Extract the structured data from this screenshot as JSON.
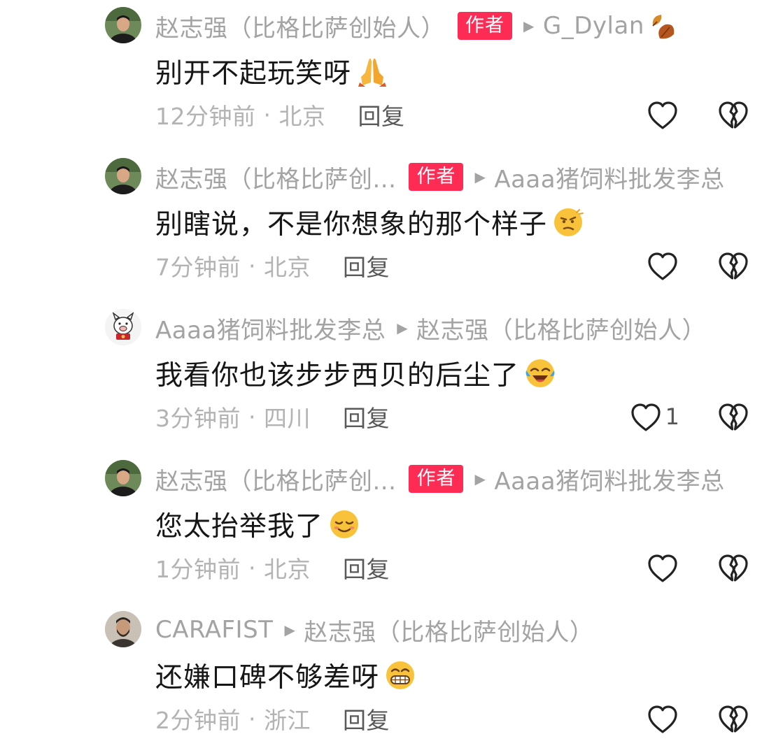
{
  "comments": [
    {
      "author": "赵志强（比格比萨创始人）",
      "author_badge": "作者",
      "reply_to": "G_Dylan",
      "reply_to_emoji": "maple-leaf-icon",
      "text": "别开不起玩笑呀",
      "emoji": "praying-hands-emoji",
      "time": "12分钟前",
      "location": "北京",
      "reply_label": "回复",
      "like_count": "",
      "avatar": "man-black-shirt-avatar"
    },
    {
      "author": "赵志强（比格比萨创...",
      "author_badge": "作者",
      "reply_to": "Aaaa猪饲料批发李总",
      "reply_to_emoji": "",
      "text": "别瞎说，不是你想象的那个样子",
      "emoji": "smirking-thinking-emoji",
      "time": "7分钟前",
      "location": "北京",
      "reply_label": "回复",
      "like_count": "",
      "avatar": "man-black-shirt-avatar"
    },
    {
      "author": "Aaaa猪饲料批发李总",
      "author_badge": "",
      "reply_to": "赵志强（比格比萨创始人）",
      "reply_to_emoji": "",
      "text": "我看你也该步步西贝的后尘了",
      "emoji": "crying-laughing-emoji",
      "time": "3分钟前",
      "location": "四川",
      "reply_label": "回复",
      "like_count": "1",
      "avatar": "pig-cartoon-avatar"
    },
    {
      "author": "赵志强（比格比萨创...",
      "author_badge": "作者",
      "reply_to": "Aaaa猪饲料批发李总",
      "reply_to_emoji": "",
      "text": "您太抬举我了",
      "emoji": "smiling-closed-eyes-emoji",
      "time": "1分钟前",
      "location": "北京",
      "reply_label": "回复",
      "like_count": "",
      "avatar": "man-black-shirt-avatar"
    },
    {
      "author": "CARAFIST",
      "author_badge": "",
      "reply_to": "赵志强（比格比萨创始人）",
      "reply_to_emoji": "",
      "text": "还嫌口碑不够差呀",
      "emoji": "grinning-teeth-emoji",
      "time": "2分钟前",
      "location": "浙江",
      "reply_label": "回复",
      "like_count": "",
      "avatar": "bearded-man-avatar"
    }
  ],
  "colors": {
    "badge": "#fe2c55",
    "meta_text": "#a3a3a3",
    "content_text": "#161616",
    "reply_text": "#595959"
  }
}
